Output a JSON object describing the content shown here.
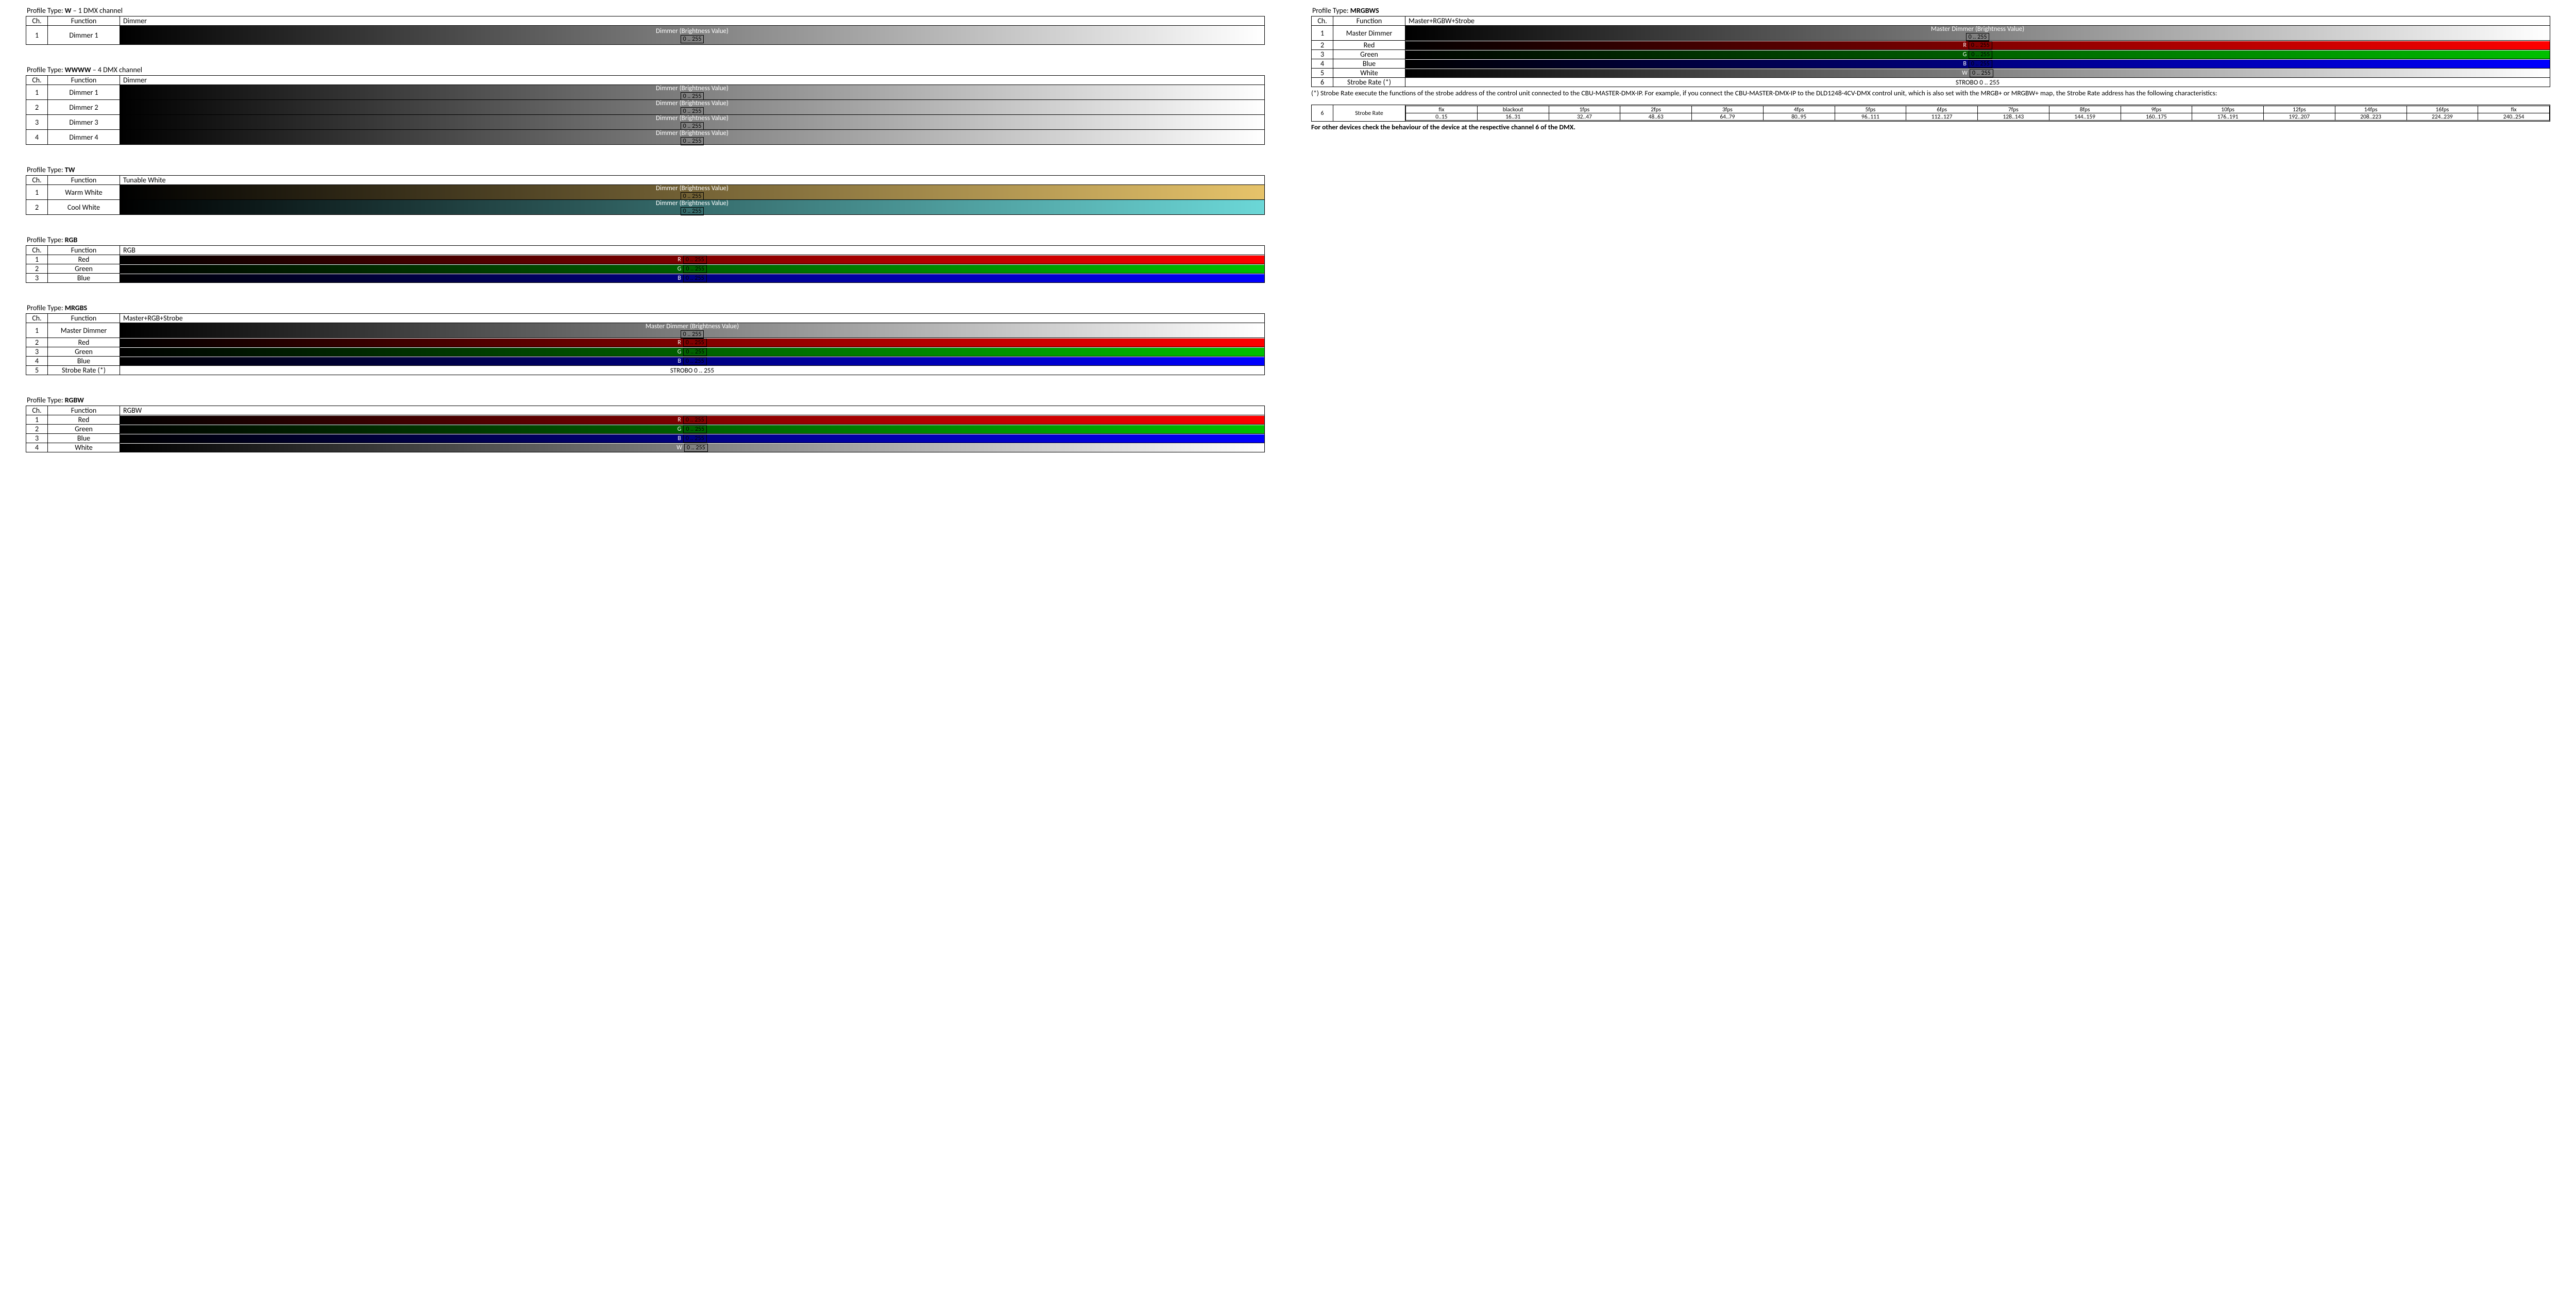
{
  "headers": {
    "ch": "Ch.",
    "fn": "Function"
  },
  "common": {
    "dimmer_top": "Dimmer (Brightness Value)",
    "master_top": "Master Dimmer (Brightness Value)",
    "range": "0 .. 255",
    "strobo": "STROBO 0 .. 255",
    "R": "R",
    "G": "G",
    "B": "B",
    "W": "W"
  },
  "profiles": {
    "W": {
      "title_pre": "Profile Type: ",
      "title_bold": "W",
      "title_post": " – 1 DMX channel",
      "col3": "Dimmer",
      "rows": [
        {
          "ch": "1",
          "fn": "Dimmer 1"
        }
      ]
    },
    "WWWW": {
      "title_pre": "Profile Type: ",
      "title_bold": "WWWW",
      "title_post": " – 4 DMX channel",
      "col3": "Dimmer",
      "rows": [
        {
          "ch": "1",
          "fn": "Dimmer 1"
        },
        {
          "ch": "2",
          "fn": "Dimmer 2"
        },
        {
          "ch": "3",
          "fn": "Dimmer 3"
        },
        {
          "ch": "4",
          "fn": "Dimmer 4"
        }
      ]
    },
    "TW": {
      "title_pre": "Profile Type: ",
      "title_bold": "TW",
      "col3": "Tunable White",
      "rows": [
        {
          "ch": "1",
          "fn": "Warm White"
        },
        {
          "ch": "2",
          "fn": "Cool White"
        }
      ]
    },
    "RGB": {
      "title_pre": "Profile Type: ",
      "title_bold": "RGB",
      "col3": "RGB",
      "rows": [
        {
          "ch": "1",
          "fn": "Red"
        },
        {
          "ch": "2",
          "fn": "Green"
        },
        {
          "ch": "3",
          "fn": "Blue"
        }
      ]
    },
    "MRGBS": {
      "title_pre": "Profile Type: ",
      "title_bold": "MRGBS",
      "col3": "Master+RGB+Strobe",
      "rows": [
        {
          "ch": "1",
          "fn": "Master Dimmer"
        },
        {
          "ch": "2",
          "fn": "Red"
        },
        {
          "ch": "3",
          "fn": "Green"
        },
        {
          "ch": "4",
          "fn": "Blue"
        },
        {
          "ch": "5",
          "fn": "Strobe Rate (*)"
        }
      ]
    },
    "RGBW": {
      "title_pre": "Profile Type: ",
      "title_bold": "RGBW",
      "col3": "RGBW",
      "rows": [
        {
          "ch": "1",
          "fn": "Red"
        },
        {
          "ch": "2",
          "fn": "Green"
        },
        {
          "ch": "3",
          "fn": "Blue"
        },
        {
          "ch": "4",
          "fn": "White"
        }
      ]
    },
    "MRGBWS": {
      "title_pre": "Profile Type: ",
      "title_bold": "MRGBWS",
      "col3": "Master+RGBW+Strobe",
      "rows": [
        {
          "ch": "1",
          "fn": "Master Dimmer"
        },
        {
          "ch": "2",
          "fn": "Red"
        },
        {
          "ch": "3",
          "fn": "Green"
        },
        {
          "ch": "4",
          "fn": "Blue"
        },
        {
          "ch": "5",
          "fn": "White"
        },
        {
          "ch": "6",
          "fn": "Strobe Rate (*)"
        }
      ]
    }
  },
  "footnote1": "(*) Strobe Rate execute the functions of the strobe address of the control unit connected to the CBU-MASTER-DMX-IP. For example, if you connect the CBU-MASTER-DMX-IP to the DLD1248-4CV-DMX control unit, which is also set with the MRGB+ or MRGBW+ map, the Strobe Rate address has the following characteristics:",
  "strobe_detail": {
    "ch": "6",
    "fn": "Strobe Rate",
    "labels": [
      "fix",
      "blackout",
      "1fps",
      "2fps",
      "3fps",
      "4fps",
      "5fps",
      "6fps",
      "7fps",
      "8fps",
      "9fps",
      "10fps",
      "12fps",
      "14fps",
      "16fps",
      "fix"
    ],
    "ranges": [
      "0..15",
      "16..31",
      "32..47",
      "48..63",
      "64..79",
      "80..95",
      "96..111",
      "112..127",
      "128..143",
      "144..159",
      "160..175",
      "176..191",
      "192..207",
      "208..223",
      "224..239",
      "240..254"
    ]
  },
  "footnote2": "For other devices check the behaviour of the device at the respective channel 6 of the DMX."
}
